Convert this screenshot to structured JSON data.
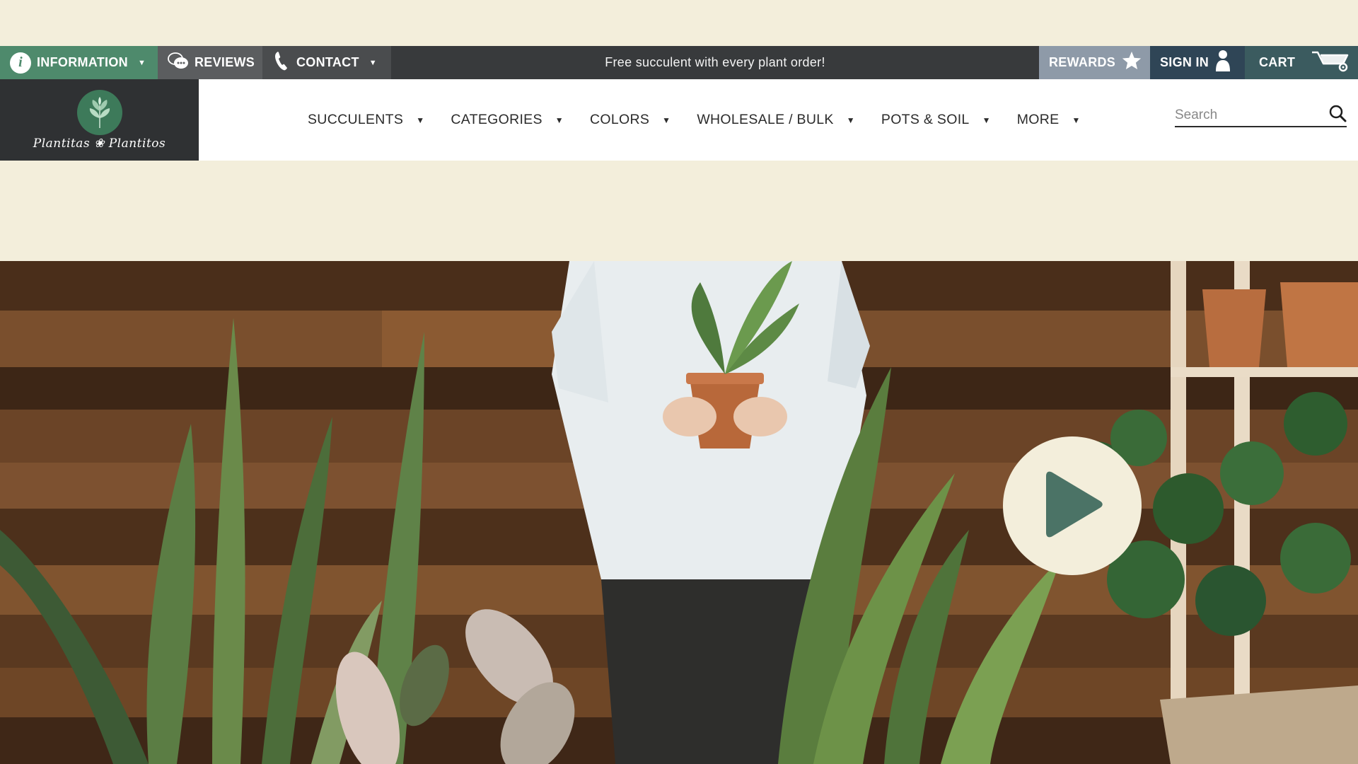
{
  "topbar": {
    "information_label": "INFORMATION",
    "reviews_label": "REVIEWS",
    "contact_label": "CONTACT",
    "promo_text": "Free succulent with every plant order!",
    "rewards_label": "REWARDS",
    "signin_label": "SIGN IN",
    "cart_label": "CART"
  },
  "logo": {
    "text": "Plantitas ❀ Plantitos"
  },
  "nav": {
    "items": [
      {
        "label": "SUCCULENTS"
      },
      {
        "label": "CATEGORIES"
      },
      {
        "label": "COLORS"
      },
      {
        "label": "WHOLESALE / BULK"
      },
      {
        "label": "POTS & SOIL"
      },
      {
        "label": "MORE"
      }
    ]
  },
  "search": {
    "placeholder": "Search"
  },
  "colors": {
    "background": "#f3eedb",
    "topbar": "#383a3c",
    "information": "#4e8a6c",
    "rewards": "#8e9aa8",
    "signin": "#2f4556",
    "cart": "#3b5b5f",
    "play_button": "#f3eedb",
    "play_icon": "#4b7366"
  },
  "icons": {
    "information": "info-icon",
    "reviews": "chat-bubbles-icon",
    "contact": "phone-icon",
    "rewards": "star-icon",
    "signin": "user-icon",
    "cart": "wheelbarrow-icon",
    "search": "search-icon",
    "hero": "play-icon"
  }
}
